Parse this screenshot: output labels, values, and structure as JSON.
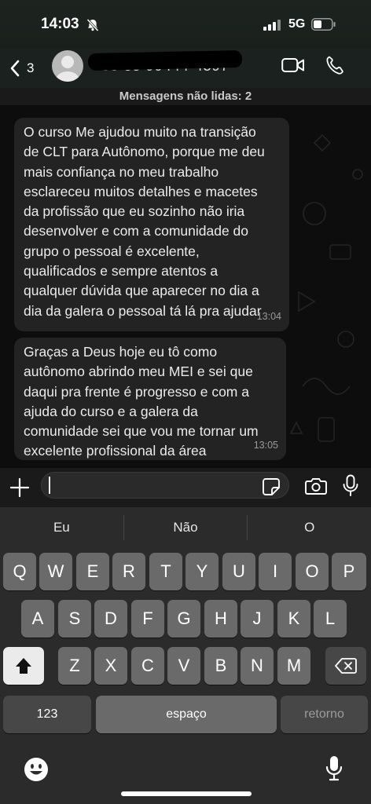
{
  "status_bar": {
    "time": "14:03",
    "network": "5G"
  },
  "header": {
    "back_count": "3",
    "contact_name": "+55 35 99444-4597"
  },
  "chat": {
    "unread_banner": "Mensagens não lidas: 2",
    "messages": [
      {
        "lines": [
          "O curso Me ajudou muito na transição",
          "de CLT para Autônomo, porque me deu",
          "mais confiança no meu trabalho",
          "esclareceu muitos detalhes e macetes",
          "da profissão que eu sozinho não iria",
          "desenvolver e com a comunidade do",
          "grupo o pessoal é excelente,",
          "qualificados e sempre atentos a",
          "qualquer dúvida que aparecer no dia a",
          "dia da galera o pessoal tá lá pra ajudar"
        ],
        "time": "13:04"
      },
      {
        "lines": [
          "Graças a Deus hoje eu tô como",
          "autônomo abrindo meu MEI e sei que",
          "daqui pra frente é progresso e com a",
          "ajuda do curso e a galera da",
          "comunidade sei que vou me tornar um",
          "excelente profissional da área"
        ],
        "time": "13:05"
      }
    ]
  },
  "composer": {
    "input_value": ""
  },
  "keyboard": {
    "suggestions": [
      "Eu",
      "Não",
      "O"
    ],
    "row1": [
      "Q",
      "W",
      "E",
      "R",
      "T",
      "Y",
      "U",
      "I",
      "O",
      "P"
    ],
    "row2": [
      "A",
      "S",
      "D",
      "F",
      "G",
      "H",
      "J",
      "K",
      "L"
    ],
    "row3": [
      "Z",
      "X",
      "C",
      "V",
      "B",
      "N",
      "M"
    ],
    "numbers_label": "123",
    "space_label": "espaço",
    "return_label": "retorno"
  },
  "colors": {
    "bubble": "#232323",
    "keyboard_bg": "#2b2b2b",
    "key": "#6a6a6a",
    "key_dark": "#474747"
  },
  "icons": [
    "bell-slash-icon",
    "signal-bars-icon",
    "battery-icon",
    "chevron-left-icon",
    "video-camera-icon",
    "phone-icon",
    "plus-icon",
    "sticker-icon",
    "camera-icon",
    "microphone-icon",
    "shift-arrow-icon",
    "delete-key-icon",
    "emoji-icon"
  ]
}
